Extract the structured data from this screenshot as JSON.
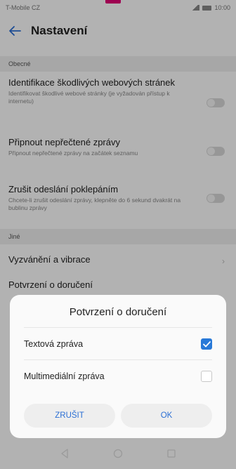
{
  "status_bar": {
    "carrier": "T-Mobile CZ",
    "time": "10:00"
  },
  "app_bar": {
    "title": "Nastavení"
  },
  "sections": {
    "general": "Obecné",
    "other": "Jiné"
  },
  "settings": [
    {
      "title": "Identifikace škodlivých webových stránek",
      "description": "Identifikovat škodlivé webové stránky (je vyžadován přístup k internetu)",
      "enabled": false
    },
    {
      "title": "Připnout nepřečtené zprávy",
      "description": "Připnout nepřečtené zprávy na začátek seznamu",
      "enabled": false
    },
    {
      "title": "Zrušit odeslání poklepáním",
      "description": "Chcete-li zrušit odeslání zprávy, klepněte do 6 sekund dvakrát na bublinu zprávy",
      "enabled": false
    }
  ],
  "other_items": {
    "ringtone": "Vyzvánění a vibrace",
    "delivery": "Potvrzení o doručení"
  },
  "dialog": {
    "title": "Potvrzení o doručení",
    "options": [
      {
        "label": "Textová zpráva",
        "checked": true
      },
      {
        "label": "Multimediální zpráva",
        "checked": false
      }
    ],
    "cancel_label": "ZRUŠIT",
    "ok_label": "OK"
  },
  "colors": {
    "brand_magenta": "#e20074",
    "accent_blue": "#2879d8"
  }
}
